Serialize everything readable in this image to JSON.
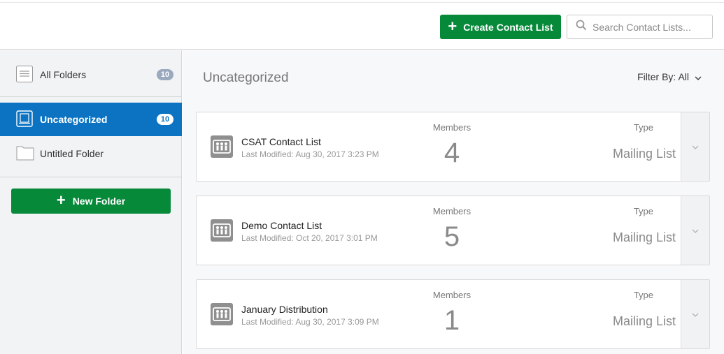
{
  "header": {
    "create_label": "Create Contact List",
    "search_placeholder": "Search Contact Lists..."
  },
  "sidebar": {
    "items": [
      {
        "label": "All Folders",
        "count": "10"
      },
      {
        "label": "Uncategorized",
        "count": "10"
      },
      {
        "label": "Untitled Folder"
      }
    ],
    "new_folder_label": "New Folder"
  },
  "main": {
    "title": "Uncategorized",
    "filter_label": "Filter By: All",
    "members_label": "Members",
    "type_label": "Type",
    "lists": [
      {
        "name": "CSAT Contact List",
        "modified": "Last Modified: Aug 30, 2017 3:23 PM",
        "members": "4",
        "type": "Mailing List"
      },
      {
        "name": "Demo Contact List",
        "modified": "Last Modified: Oct 20, 2017 3:01 PM",
        "members": "5",
        "type": "Mailing List"
      },
      {
        "name": "January Distribution",
        "modified": "Last Modified: Aug 30, 2017 3:09 PM",
        "members": "1",
        "type": "Mailing List"
      }
    ]
  },
  "colors": {
    "accent_green": "#07893a",
    "active_blue": "#0b73c2",
    "badge_gray": "#9aa9bd"
  }
}
